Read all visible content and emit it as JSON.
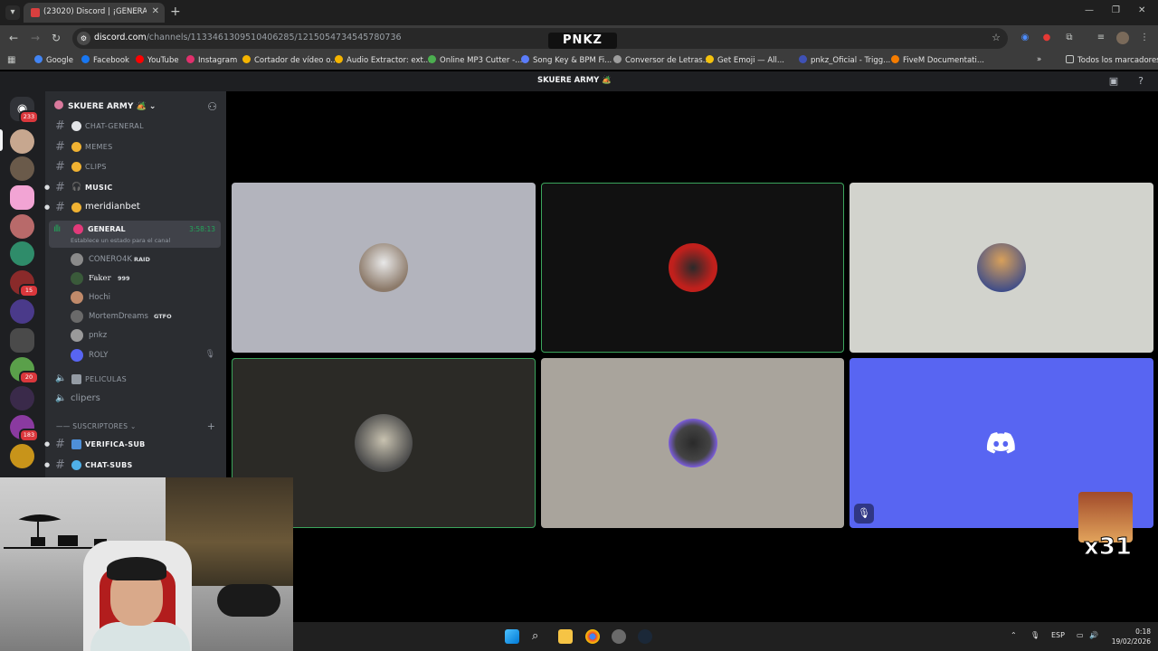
{
  "browser": {
    "tab_title": "(23020) Discord | ¡GENERAL",
    "url_host": "discord.com",
    "url_path": "/channels/1133461309510406285/1215054734545780736",
    "overlay_logo": "PNKZ",
    "bookmarks": [
      {
        "label": "Google",
        "color": "#4285f4"
      },
      {
        "label": "Facebook",
        "color": "#1877f2"
      },
      {
        "label": "YouTube",
        "color": "#ff0000"
      },
      {
        "label": "Instagram",
        "color": "#e1306c"
      },
      {
        "label": "Cortador de vídeo o...",
        "color": "#f4b400"
      },
      {
        "label": "Audio Extractor: ext...",
        "color": "#f4b400"
      },
      {
        "label": "Online MP3 Cutter -...",
        "color": "#4caf50"
      },
      {
        "label": "Song Key & BPM Fi...",
        "color": "#5b7cfa"
      },
      {
        "label": "Conversor de Letras...",
        "color": "#9e9e9e"
      },
      {
        "label": "Get Emoji — All...",
        "color": "#f4c20d"
      },
      {
        "label": "pnkz_Oficial - Trigg...",
        "color": "#3f51b5"
      },
      {
        "label": "FiveM Documentati...",
        "color": "#f57c00"
      }
    ],
    "all_bookmarks_label": "Todos los marcadores"
  },
  "discord": {
    "header_title": "SKUERE ARMY 🏕️",
    "server_name": "SKUERE ARMY 🏕️",
    "home_badge": "233",
    "guild_badges": [
      "15",
      "1",
      "20",
      "183"
    ],
    "channels": [
      {
        "name": "CHAT-GENERAL",
        "emoji_color": "#e3e5e8"
      },
      {
        "name": "MEMES",
        "emoji_color": "#f0b232"
      },
      {
        "name": "CLIPS",
        "emoji_color": "#f0b232"
      },
      {
        "name": "MUSIC",
        "emoji_color": "#dbdee1"
      },
      {
        "name": "meridianbet",
        "emoji_color": "#f0b232"
      }
    ],
    "voice": {
      "channel_name": "GENERAL",
      "timer": "3:58:13",
      "status_placeholder": "Establece un estado para el canal"
    },
    "members": [
      {
        "name": "CONERO4K",
        "tag": "RAID",
        "color": "#8a8a8a"
      },
      {
        "name": "Faker",
        "tag": "999",
        "color": "#3a5a3a"
      },
      {
        "name": "Hochi",
        "tag": "",
        "color": "#c08a6a"
      },
      {
        "name": "MortemDreams",
        "tag": "GTFO",
        "color": "#6a6a6a"
      },
      {
        "name": "pnkz",
        "tag": "",
        "color": "#9a9a9a"
      },
      {
        "name": "ROLY",
        "tag": "",
        "color": "#5865f2"
      }
    ],
    "voice_channels": [
      {
        "name": "PELICULAS"
      },
      {
        "name": "clipers"
      }
    ],
    "category": "SUSCRIPTORES",
    "sub_channels": [
      {
        "name": "VERIFICA-SUB"
      },
      {
        "name": "CHAT-SUBS"
      }
    ],
    "tiles": [
      {
        "bg": "#b3b4bd",
        "avatar": "#8c7a6a",
        "speaking": false
      },
      {
        "bg": "#111111",
        "avatar": "#c0201c",
        "speaking": true
      },
      {
        "bg": "#d2d3cd",
        "avatar": "#d8a05a",
        "speaking": false
      },
      {
        "bg": "#2b2a26",
        "avatar": "#c8c2b0",
        "speaking": true
      },
      {
        "bg": "#a9a49c",
        "avatar": "#7a5cd8",
        "speaking": false
      },
      {
        "bg": "#5865f2",
        "avatar": "",
        "speaking": false
      }
    ]
  },
  "overlay": {
    "multiplier": "x31"
  },
  "taskbar": {
    "language": "ESP",
    "time": "0:18",
    "date": "19/02/2026"
  }
}
